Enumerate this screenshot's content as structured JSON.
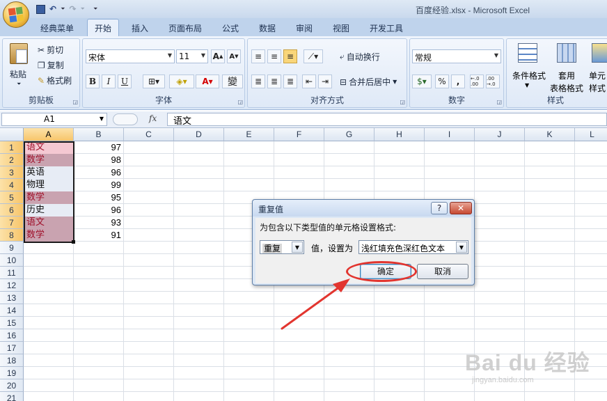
{
  "window": {
    "title": "百度经验.xlsx - Microsoft Excel"
  },
  "qat": {
    "dropdown": "⏷"
  },
  "tabs": [
    {
      "label": "经典菜单"
    },
    {
      "label": "开始"
    },
    {
      "label": "插入"
    },
    {
      "label": "页面布局"
    },
    {
      "label": "公式"
    },
    {
      "label": "数据"
    },
    {
      "label": "审阅"
    },
    {
      "label": "视图"
    },
    {
      "label": "开发工具"
    }
  ],
  "ribbon": {
    "clipboard": {
      "label": "剪贴板",
      "paste": "粘贴",
      "cut": "剪切",
      "copy": "复制",
      "format_painter": "格式刷"
    },
    "font": {
      "label": "字体",
      "font_name": "宋体",
      "font_size": "11",
      "bold": "B",
      "italic": "I",
      "underline": "U",
      "wen": "變"
    },
    "alignment": {
      "label": "对齐方式",
      "wrap_text": "自动换行",
      "merge_center": "合并后居中"
    },
    "number": {
      "label": "数字",
      "format": "常规",
      "percent": "%",
      "comma": ",",
      "inc_decimal": "←.0 .00",
      "dec_decimal": ".00 →.0"
    },
    "styles": {
      "label": "样式",
      "conditional_format": "条件格式",
      "table_format_1": "套用",
      "table_format_2": "表格格式",
      "cell_styles_1": "单元",
      "cell_styles_2": "样式"
    }
  },
  "formula_bar": {
    "name_box": "A1",
    "fx": "fx",
    "content": "语文"
  },
  "columns": [
    "A",
    "B",
    "C",
    "D",
    "E",
    "F",
    "G",
    "H",
    "I",
    "J",
    "K",
    "L"
  ],
  "rows": [
    "1",
    "2",
    "3",
    "4",
    "5",
    "6",
    "7",
    "8",
    "9",
    "10",
    "11",
    "12",
    "13",
    "14",
    "15",
    "16",
    "17",
    "18",
    "19",
    "20",
    "21"
  ],
  "cells": [
    {
      "a": "语文",
      "b": "97",
      "dup": true
    },
    {
      "a": "数学",
      "b": "98",
      "dup": true
    },
    {
      "a": "英语",
      "b": "96",
      "dup": false
    },
    {
      "a": "物理",
      "b": "99",
      "dup": false
    },
    {
      "a": "数学",
      "b": "95",
      "dup": true
    },
    {
      "a": "历史",
      "b": "96",
      "dup": false
    },
    {
      "a": "语文",
      "b": "93",
      "dup": true
    },
    {
      "a": "数学",
      "b": "91",
      "dup": true
    }
  ],
  "colors": {
    "dup_fill": "#c9a3b0",
    "dup_text": "#a0102a",
    "sel_fill": "#e7ecf5",
    "annotation": "#e2352f"
  },
  "dialog": {
    "title": "重复值",
    "help": "?",
    "close": "✕",
    "prompt": "为包含以下类型值的单元格设置格式:",
    "type_value": "重复",
    "set_as_label": "值，设置为",
    "format_value": "浅红填充色深红色文本",
    "ok": "确定",
    "cancel": "取消"
  },
  "watermark": {
    "main": "Bai du 经验",
    "sub": "jingyan.baidu.com"
  }
}
